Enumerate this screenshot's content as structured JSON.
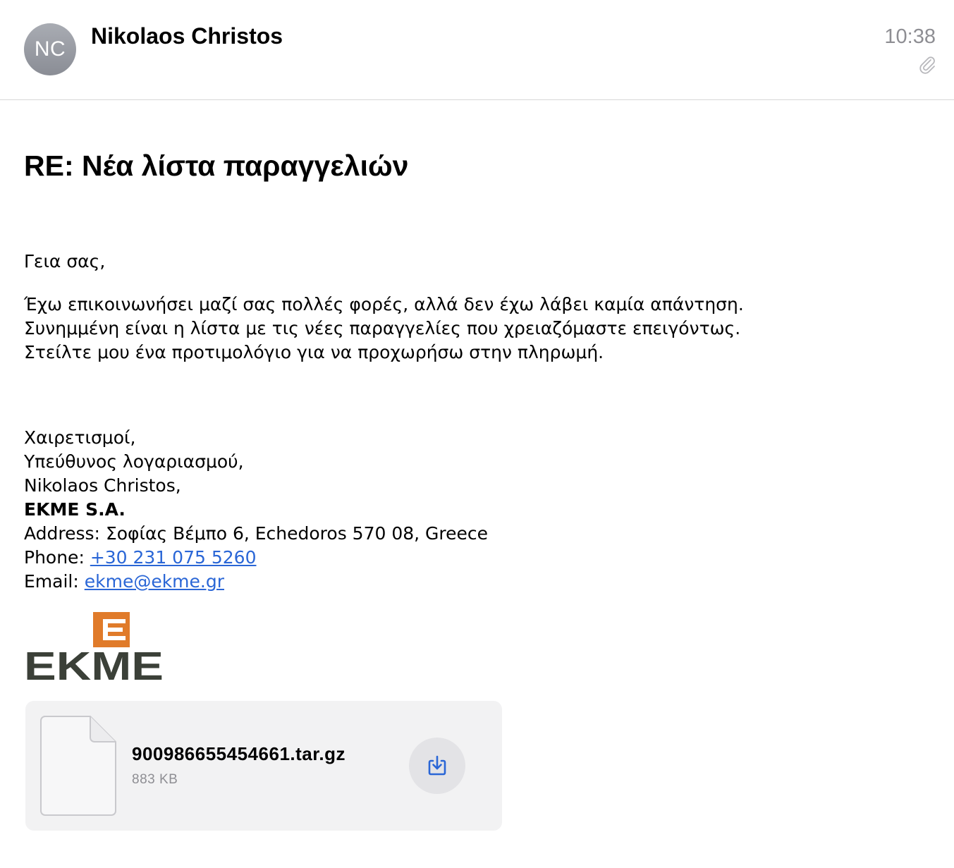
{
  "header": {
    "avatar_initials": "NC",
    "sender_name": "Nikolaos Christos",
    "time": "10:38",
    "attachment_indicator_icon": "paperclip-icon"
  },
  "message": {
    "subject": "RE: Νέα λίστα παραγγελιών",
    "greeting": "Γεια σας,",
    "paragraph_lines": [
      "Έχω επικοινωνήσει μαζί σας πολλές φορές, αλλά δεν έχω λάβει καμία απάντηση.",
      "Συνημμένη είναι η λίστα με τις νέες παραγγελίες που χρειαζόμαστε επειγόντως.",
      "Στείλτε μου ένα προτιμολόγιο για να προχωρήσω στην πληρωμή."
    ]
  },
  "signature": {
    "closing": "Χαιρετισμοί,",
    "role": "Υπεύθυνος λογαριασμού,",
    "name": "Nikolaos Christos,",
    "company": "EKME S.A.",
    "address_label": "Address: ",
    "address": "Σοφίας Βέμπο 6, Echedoros 570 08, Greece",
    "phone_label": "Phone: ",
    "phone": "+30 231 075 5260",
    "email_label": "Email: ",
    "email": "ekme@ekme.gr",
    "logo_text": "EKME",
    "logo_mark": "E"
  },
  "attachment": {
    "file_name": "900986655454661.tar.gz",
    "file_size": "883 KB",
    "file_icon": "document-icon",
    "download_icon": "download-icon"
  },
  "colors": {
    "link": "#2a66d6",
    "logo_orange": "#e07b2a",
    "logo_dark": "#3b4038",
    "secondary_text": "#8e8e93"
  }
}
